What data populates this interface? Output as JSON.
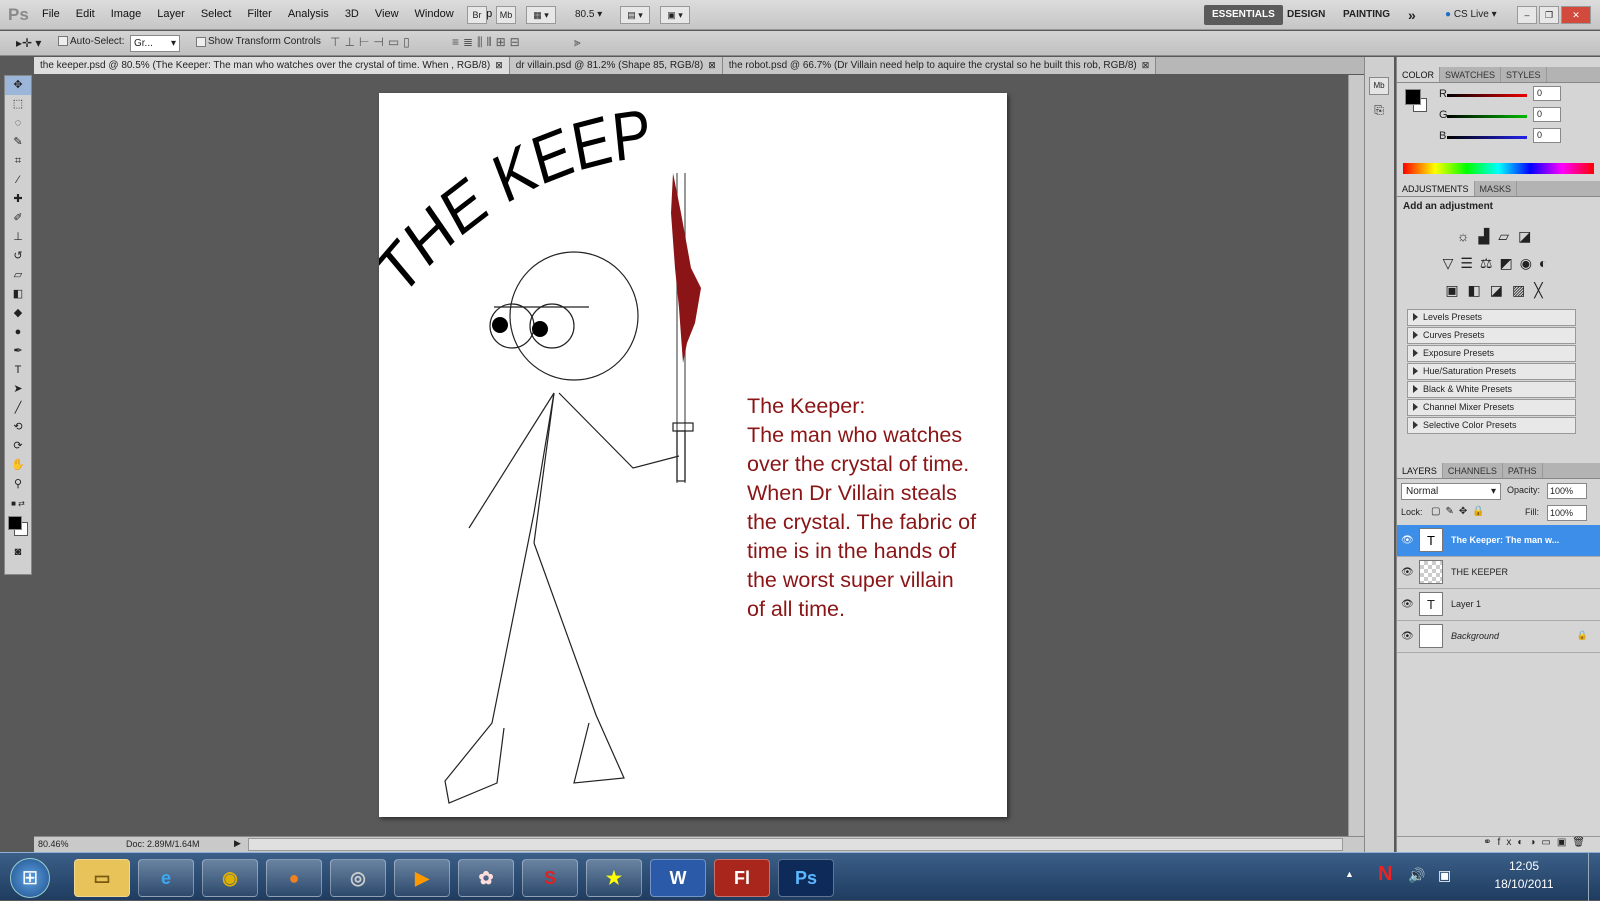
{
  "app": {
    "logo": "Ps",
    "menu": [
      "File",
      "Edit",
      "Image",
      "Layer",
      "Select",
      "Filter",
      "Analysis",
      "3D",
      "View",
      "Window",
      "Help"
    ],
    "bridge_btn": "Br",
    "minibridge_btn": "Mb",
    "zoom_value": "80.5",
    "workspaces": [
      "ESSENTIALS",
      "DESIGN",
      "PAINTING"
    ],
    "more_workspaces": "»",
    "cs_live": "CS Live"
  },
  "options": {
    "auto_select_label": "Auto-Select:",
    "auto_select_value": "Gr...",
    "show_transform_label": "Show Transform Controls"
  },
  "tabs": [
    {
      "label": "the keeper.psd @ 80.5% (The Keeper: The man who watches over the crystal of time. When , RGB/8)",
      "close": "⊠"
    },
    {
      "label": "dr villain.psd @ 81.2% (Shape 85, RGB/8)",
      "close": "⊠"
    },
    {
      "label": "the robot.psd @ 66.7% (Dr Villain need help to aquire the crystal so he built this rob, RGB/8)",
      "close": "⊠"
    }
  ],
  "artwork": {
    "title": "THE KEEPER",
    "story_lines": [
      "The Keeper:",
      "The man who watches",
      "over the crystal of time.",
      "When Dr Villain steals",
      "the crystal. The fabric of",
      "time is in the hands of",
      "the worst super villain",
      "of all time."
    ],
    "story_color": "#8b1516",
    "blood_color": "#8b1516"
  },
  "status": {
    "zoom": "80.46%",
    "doc": "Doc: 2.89M/1.64M"
  },
  "color_panel": {
    "tabs": [
      "COLOR",
      "SWATCHES",
      "STYLES"
    ],
    "channels": [
      {
        "label": "R",
        "value": "0"
      },
      {
        "label": "G",
        "value": "0"
      },
      {
        "label": "B",
        "value": "0"
      }
    ]
  },
  "adjustments": {
    "tabs": [
      "ADJUSTMENTS",
      "MASKS"
    ],
    "heading": "Add an adjustment",
    "presets": [
      "Levels Presets",
      "Curves Presets",
      "Exposure Presets",
      "Hue/Saturation Presets",
      "Black & White Presets",
      "Channel Mixer Presets",
      "Selective Color Presets"
    ]
  },
  "layers": {
    "tabs": [
      "LAYERS",
      "CHANNELS",
      "PATHS"
    ],
    "blend_mode": "Normal",
    "opacity_label": "Opacity:",
    "opacity_value": "100%",
    "lock_label": "Lock:",
    "fill_label": "Fill:",
    "fill_value": "100%",
    "items": [
      {
        "name": "The Keeper: The man w...",
        "thumb": "T"
      },
      {
        "name": "THE KEEPER",
        "thumb": ""
      },
      {
        "name": "Layer 1",
        "thumb": "T"
      },
      {
        "name": "Background",
        "thumb": ""
      }
    ]
  },
  "taskbar": {
    "start": "⊞",
    "apps": [
      "Explorer",
      "Internet Explorer",
      "Chrome",
      "Firefox",
      "Media",
      "Player",
      "Windows Live",
      "SBP",
      "Games",
      "W",
      "Fl",
      "Ps"
    ],
    "tray_n": "N",
    "time": "12:05",
    "date": "18/10/2011"
  }
}
